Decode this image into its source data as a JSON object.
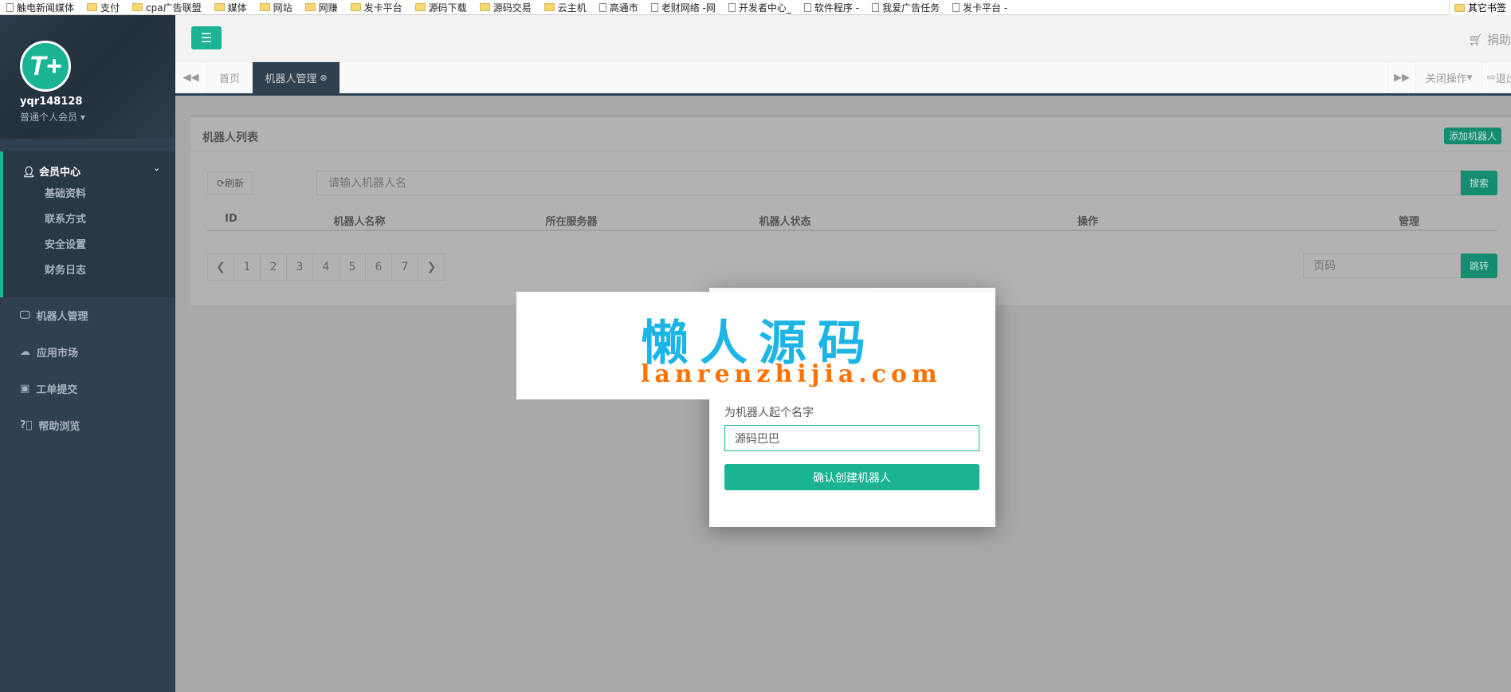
{
  "bookmarks": [
    {
      "label": "触电新闻媒体",
      "icon": "page"
    },
    {
      "label": "支付",
      "icon": "folder"
    },
    {
      "label": "cpa广告联盟",
      "icon": "folder"
    },
    {
      "label": "媒体",
      "icon": "folder"
    },
    {
      "label": "网站",
      "icon": "folder"
    },
    {
      "label": "网赚",
      "icon": "folder"
    },
    {
      "label": "发卡平台",
      "icon": "folder"
    },
    {
      "label": "源码下载",
      "icon": "folder"
    },
    {
      "label": "源码交易",
      "icon": "folder"
    },
    {
      "label": "云主机",
      "icon": "folder"
    },
    {
      "label": "高通市",
      "icon": "page"
    },
    {
      "label": "老财网络 -网",
      "icon": "page"
    },
    {
      "label": "开发者中心_",
      "icon": "page"
    },
    {
      "label": "软件程序 -",
      "icon": "page"
    },
    {
      "label": "我爱广告任务",
      "icon": "page"
    },
    {
      "label": "发卡平台 -",
      "icon": "page"
    }
  ],
  "bookmarks_other": "其它书签",
  "user": {
    "name": "yqr148128",
    "role": "普通个人会员",
    "avatar_text": "T+"
  },
  "sidebar": {
    "group": "会员中心",
    "sub_items": [
      "基础资料",
      "联系方式",
      "安全设置",
      "财务日志"
    ],
    "items": [
      {
        "label": "机器人管理",
        "icon": "monitor"
      },
      {
        "label": "应用市场",
        "icon": "cloud"
      },
      {
        "label": "工单提交",
        "icon": "calendar-plus"
      },
      {
        "label": "帮助浏览",
        "icon": "question"
      }
    ]
  },
  "header": {
    "donate": "捐助"
  },
  "tabs": {
    "home": "首页",
    "active": "机器人管理",
    "close_ops": "关闭操作",
    "logout": "退出"
  },
  "panel": {
    "title": "机器人列表",
    "add_button": "添加机器人",
    "refresh": "刷新",
    "search_placeholder": "请输入机器人名",
    "search_button": "搜索",
    "columns": [
      "ID",
      "机器人名称",
      "所在服务器",
      "机器人状态",
      "操作",
      "管理"
    ],
    "pages": [
      "1",
      "2",
      "3",
      "4",
      "5",
      "6",
      "7"
    ],
    "page_placeholder": "页码",
    "jump_button": "跳转"
  },
  "modal": {
    "label": "为机器人起个名字",
    "input_value": "源码巴巴",
    "confirm_button": "确认创建机器人"
  },
  "watermark": {
    "cn": "懒人源码",
    "en": "lanrenzhijia.com"
  },
  "colors": {
    "accent": "#1ab394",
    "sidebar": "#2f4050"
  }
}
